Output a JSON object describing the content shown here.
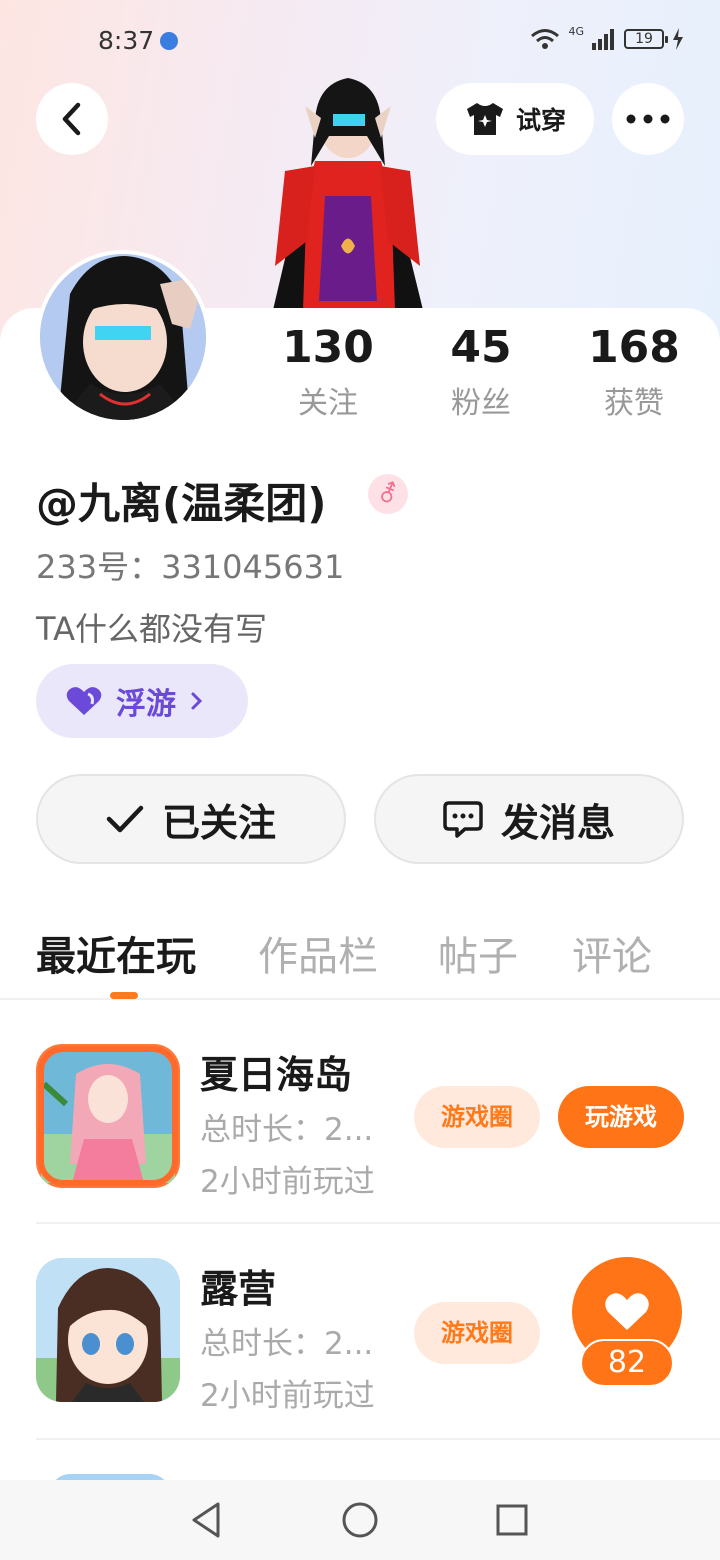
{
  "status_bar": {
    "time": "8:37",
    "network": "4G",
    "battery": "19"
  },
  "header": {
    "try_on_label": "试穿"
  },
  "profile": {
    "stats": [
      {
        "value": "130",
        "label": "关注"
      },
      {
        "value": "45",
        "label": "粉丝"
      },
      {
        "value": "168",
        "label": "获赞"
      }
    ],
    "username": "@九离(温柔团)",
    "gender_symbol": "⚦",
    "uid": "233号：331045631",
    "bio": "TA什么都没有写",
    "tag_label": "浮游"
  },
  "actions": {
    "follow_label": "已关注",
    "message_label": "发消息"
  },
  "tabs": [
    {
      "label": "最近在玩",
      "active": true
    },
    {
      "label": "作品栏",
      "active": false
    },
    {
      "label": "帖子",
      "active": false
    },
    {
      "label": "评论",
      "active": false
    }
  ],
  "games": [
    {
      "title": "夏日海岛",
      "playtime": "总时长：2...",
      "last_played": "2小时前玩过",
      "circle_label": "游戏圈",
      "play_label": "玩游戏"
    },
    {
      "title": "露营",
      "playtime": "总时长：2...",
      "last_played": "2小时前玩过",
      "circle_label": "游戏圈"
    }
  ],
  "like": {
    "count": "82"
  },
  "colors": {
    "accent": "#ff7416",
    "tag_purple": "#6b4ad9",
    "gender_pink": "#f36f8c"
  }
}
